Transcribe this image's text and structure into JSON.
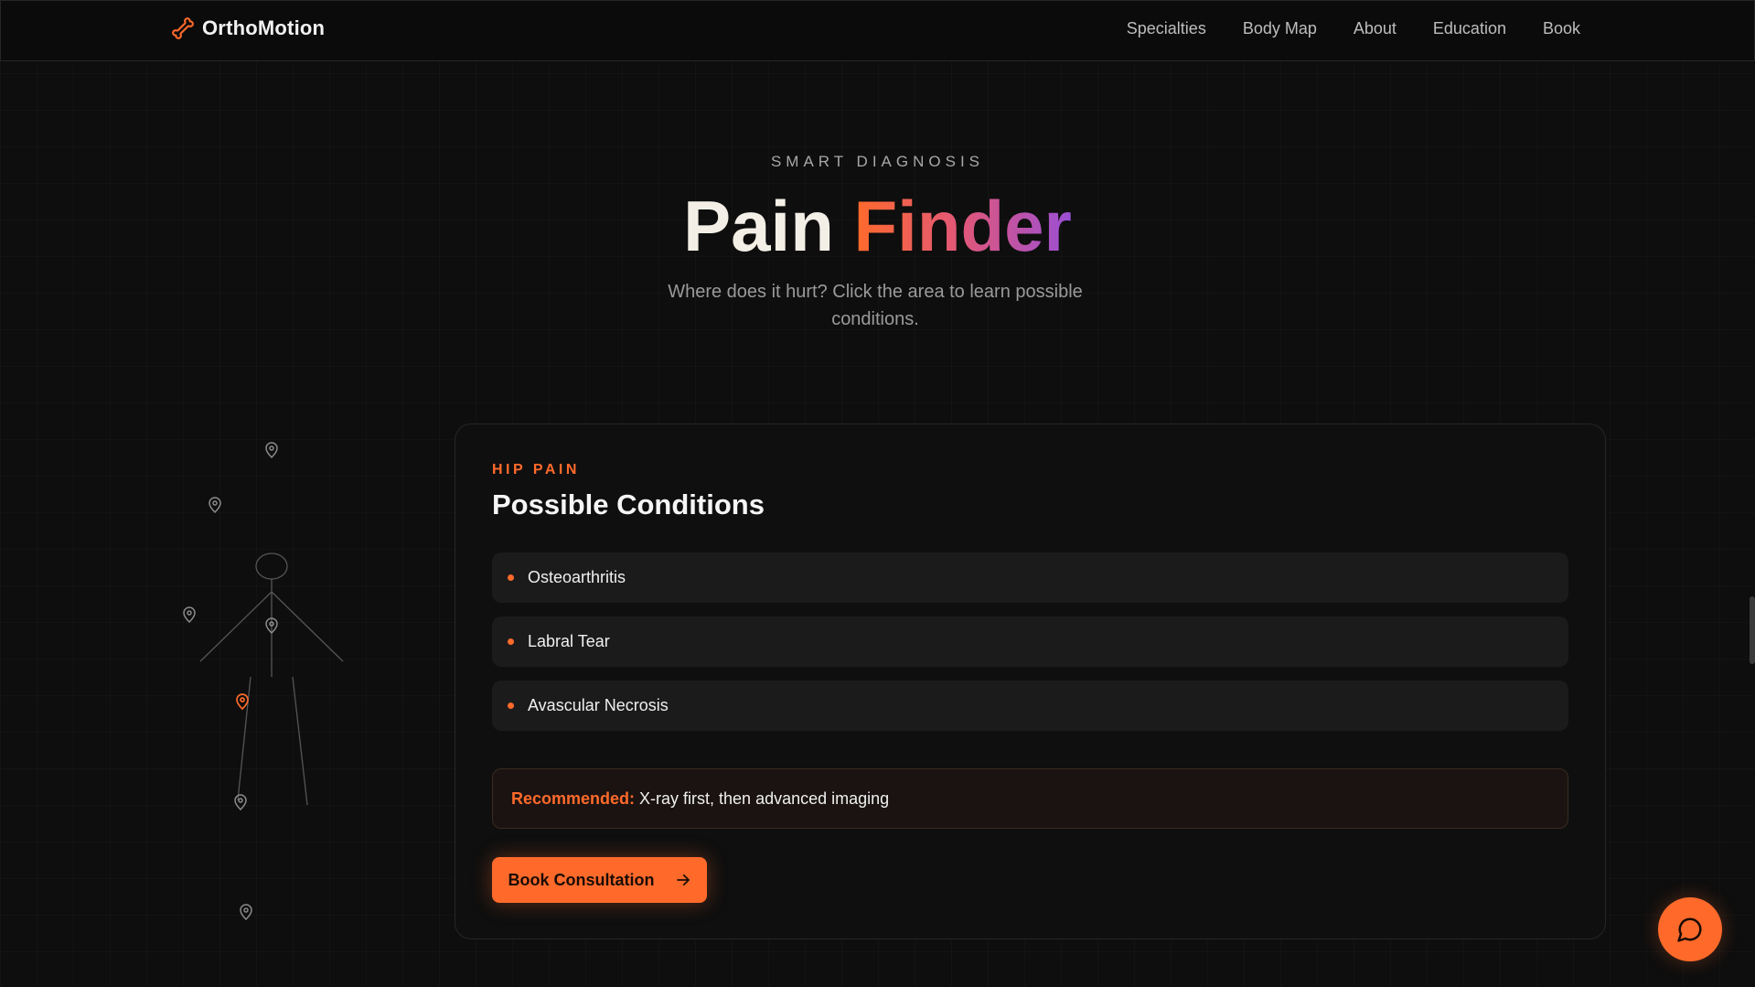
{
  "brand": {
    "name": "OrthoMotion",
    "icon": "bone-icon",
    "accent": "#ff6a2b"
  },
  "nav": {
    "items": [
      {
        "label": "Specialties"
      },
      {
        "label": "Body Map"
      },
      {
        "label": "About"
      },
      {
        "label": "Education"
      },
      {
        "label": "Book"
      }
    ]
  },
  "hero": {
    "eyebrow": "SMART DIAGNOSIS",
    "title_plain": "Pain",
    "title_accent": "Finder",
    "subtitle": "Where does it hurt? Click the area to learn possible conditions."
  },
  "body_map": {
    "pins": [
      {
        "name": "neck-pin",
        "active": false
      },
      {
        "name": "shoulder-pin",
        "active": false
      },
      {
        "name": "elbow-pin",
        "active": false
      },
      {
        "name": "back-pin",
        "active": false
      },
      {
        "name": "hip-pin",
        "active": true
      },
      {
        "name": "knee-pin",
        "active": false
      },
      {
        "name": "foot-pin",
        "active": false
      }
    ]
  },
  "panel": {
    "eyebrow": "HIP PAIN",
    "title": "Possible Conditions",
    "conditions": [
      {
        "label": "Osteoarthritis"
      },
      {
        "label": "Labral Tear"
      },
      {
        "label": "Avascular Necrosis"
      }
    ],
    "recommend_label": "Recommended:",
    "recommend_text": "X-ray first, then advanced imaging",
    "cta_label": "Book Consultation",
    "cta_icon": "arrow-right-icon"
  },
  "chat": {
    "icon": "chat-bubble-icon"
  }
}
